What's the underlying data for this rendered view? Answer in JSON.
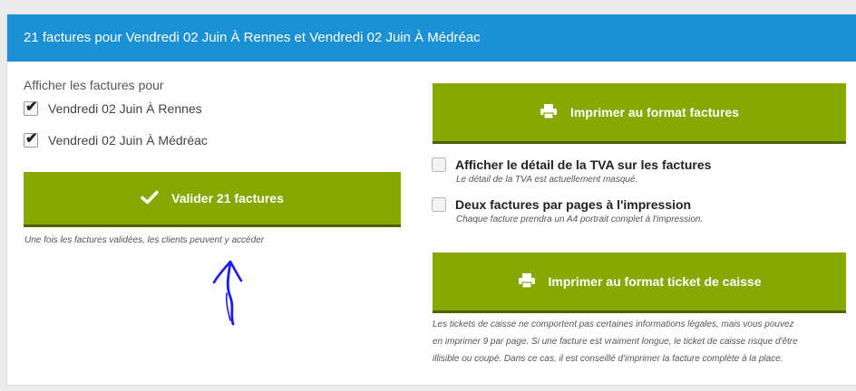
{
  "header": {
    "title": "21 factures pour Vendredi 02 Juin À Rennes et Vendredi 02 Juin À Médréac"
  },
  "filters": {
    "label": "Afficher les factures pour",
    "options": [
      {
        "label": "Vendredi 02 Juin À Rennes",
        "checked": true
      },
      {
        "label": "Vendredi 02 Juin À Médréac",
        "checked": true
      }
    ]
  },
  "validate": {
    "label": "Valider 21 factures",
    "note": "Une fois les factures validées, les clients peuvent y accéder"
  },
  "print_invoices": {
    "label": "Imprimer au format factures"
  },
  "options": {
    "tva": {
      "label": "Afficher le détail de la TVA sur les factures",
      "hint": "Le détail de la TVA est actuellement masqué.",
      "checked": false
    },
    "two_per_page": {
      "label": "Deux factures par pages à l'impression",
      "hint": "Chaque facture prendra un A4 portrait complet à l'impression.",
      "checked": false
    }
  },
  "print_ticket": {
    "label": "Imprimer au format ticket de caisse",
    "note_lines": [
      "Les tickets de caisse ne comportent pas certaines informations légales, mais vous pouvez",
      "en imprimer 9 par page. Si une facture est vraiment longue, le ticket de caisse risque d'être",
      "illisible ou coupé. Dans ce cas, il est conseillé d'imprimer la facture complète à la place."
    ]
  },
  "colors": {
    "header_bg": "#1b90d4",
    "button_bg": "#86a800",
    "button_border": "#4d6100",
    "annotation": "#1a1aff"
  },
  "icons": {
    "validate": "check-icon",
    "print": "printer-icon",
    "annotation": "hand-drawn-arrow-icon"
  }
}
